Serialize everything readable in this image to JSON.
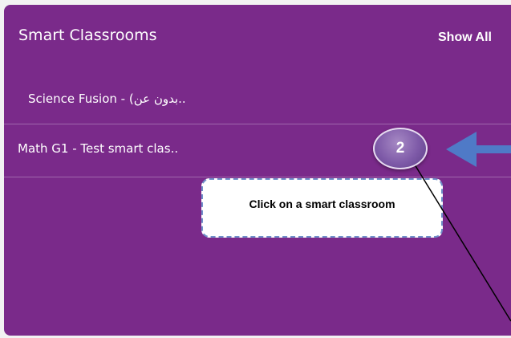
{
  "panel": {
    "title": "Smart Classrooms",
    "show_all_label": "Show All",
    "background_color": "#7a2a8a"
  },
  "classrooms": [
    {
      "label": "Science Fusion - (بدون عن.."
    },
    {
      "label": "Math G1 - Test smart clas.."
    }
  ],
  "annotation": {
    "step_number": "2",
    "instruction": "Click on  a smart classroom",
    "arrow_color": "#4f7ac7"
  }
}
